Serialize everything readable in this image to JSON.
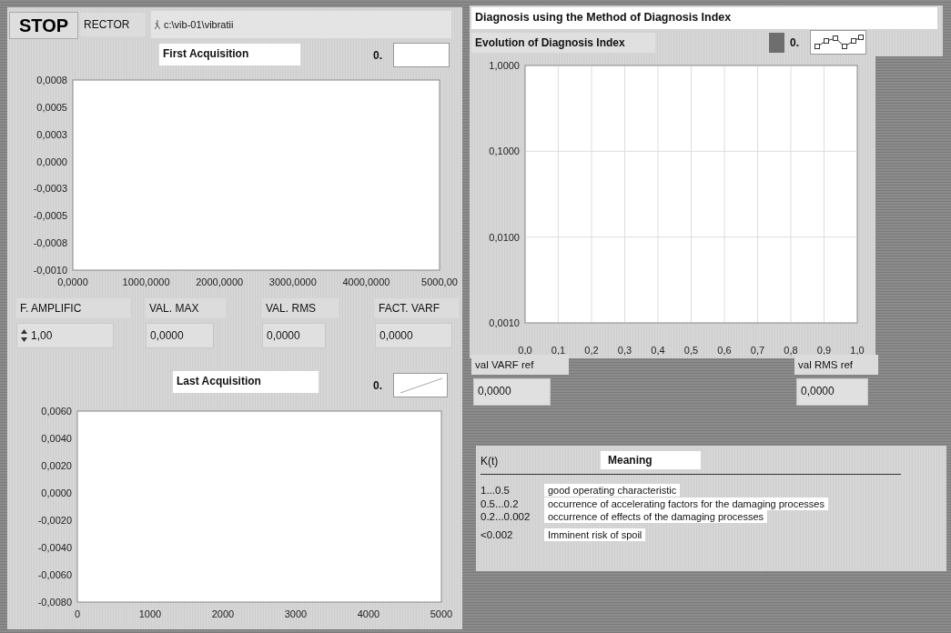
{
  "stop_button": {
    "label": "STOP"
  },
  "path_control": {
    "label": "RECTOR",
    "value": "c:\\vib-01\\vibratii"
  },
  "first_acquisition": {
    "label": "First Acquisition",
    "legend": {
      "plot": "0.",
      "kind": "empty"
    },
    "graph": {
      "x_axis_labels": [
        "0,0000",
        "1000,0000",
        "2000,0000",
        "3000,0000",
        "4000,0000",
        "5000,00"
      ],
      "y_axis_labels": [
        "0,0008",
        "0,0005",
        "0,0003",
        "0,0000",
        "-0,0003",
        "-0,0005",
        "-0,0008",
        "-0,0010"
      ]
    }
  },
  "indicators": [
    {
      "label": "F. AMPLIFIC",
      "value": "1,00",
      "kind": "control"
    },
    {
      "label": "VAL. MAX",
      "value": "0,0000",
      "kind": "indicator"
    },
    {
      "label": "VAL. RMS",
      "value": "0,0000",
      "kind": "indicator"
    },
    {
      "label": "FACT. VARF",
      "value": "0,0000",
      "kind": "indicator"
    }
  ],
  "last_acquisition": {
    "label": "Last Acquisition",
    "legend": {
      "plot": "0.",
      "kind": "line"
    },
    "graph": {
      "x_axis_labels": [
        "0",
        "1000",
        "2000",
        "3000",
        "4000",
        "5000"
      ],
      "y_axis_labels": [
        "0,0060",
        "0,0040",
        "0,0020",
        "0,0000",
        "-0,0020",
        "-0,0040",
        "-0,0060",
        "-0,0080"
      ]
    }
  },
  "diagnosis": {
    "title": "Diagnosis using the Method of  Diagnosis Index",
    "chart": {
      "label": "Evolution of Diagnosis Index",
      "legend": {
        "plot": "0.",
        "kind": "line-points"
      },
      "graph": {
        "x_axis_labels": [
          "0,0",
          "0,1",
          "0,2",
          "0,3",
          "0,4",
          "0,5",
          "0,6",
          "0,7",
          "0,8",
          "0,9",
          "1,0"
        ],
        "y_axis_labels": [
          "1,0000",
          "0,1000",
          "0,0100",
          "0,0010"
        ]
      }
    },
    "references": [
      {
        "label": "val VARF ref",
        "value": "0,0000"
      },
      {
        "label": "val RMS ref",
        "value": "0,0000"
      }
    ],
    "table": {
      "columns": [
        "K(t)",
        "Meaning"
      ],
      "rows": [
        {
          "range": "1...0.5",
          "meaning": "good operating characteristic"
        },
        {
          "range": "0.5...0.2",
          "meaning": "occurrence of accelerating factors for the damaging processes"
        },
        {
          "range": "0.2...0.002",
          "meaning": "occurrence of effects of the damaging processes"
        },
        {
          "range": "<0.002",
          "meaning": "Imminent risk of spoil"
        }
      ]
    }
  }
}
